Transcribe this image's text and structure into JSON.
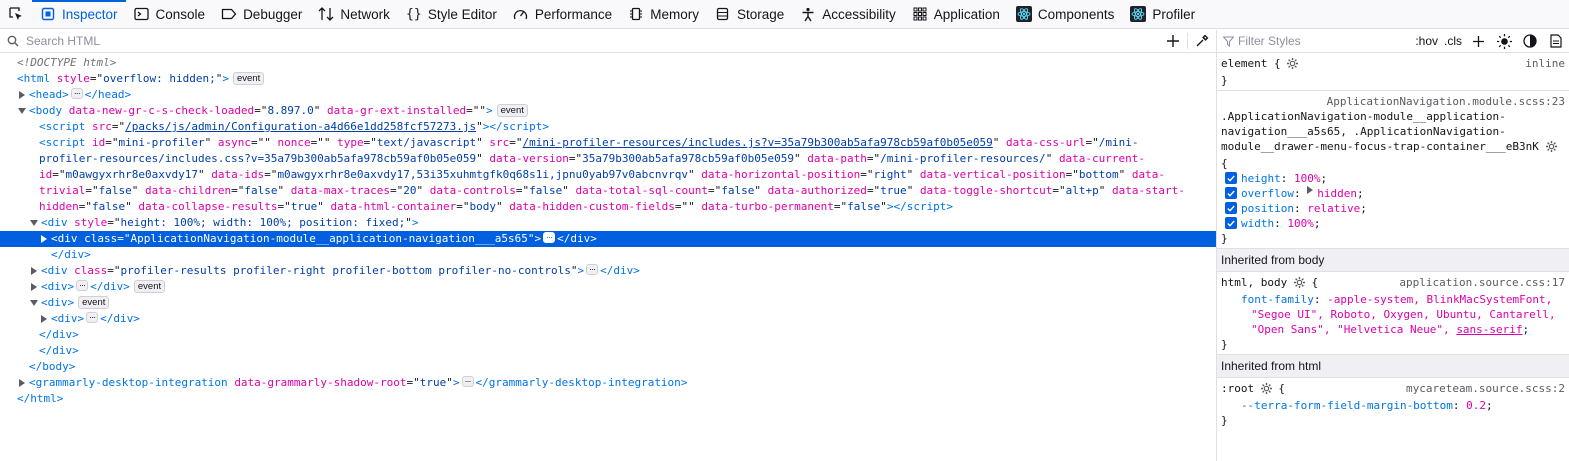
{
  "toolbar": {
    "tabs": [
      {
        "label": "Inspector",
        "icon": "inspector-icon",
        "selected": true
      },
      {
        "label": "Console",
        "icon": "console-icon"
      },
      {
        "label": "Debugger",
        "icon": "debugger-icon"
      },
      {
        "label": "Network",
        "icon": "network-icon"
      },
      {
        "label": "Style Editor",
        "icon": "style-editor-icon"
      },
      {
        "label": "Performance",
        "icon": "performance-icon"
      },
      {
        "label": "Memory",
        "icon": "memory-icon"
      },
      {
        "label": "Storage",
        "icon": "storage-icon"
      },
      {
        "label": "Accessibility",
        "icon": "accessibility-icon"
      },
      {
        "label": "Application",
        "icon": "application-icon"
      },
      {
        "label": "Components",
        "icon": "react-icon"
      },
      {
        "label": "Profiler",
        "icon": "react-icon"
      }
    ]
  },
  "markup": {
    "search_placeholder": "Search HTML",
    "lines": {
      "doctype": "<!DOCTYPE html>",
      "html_open": {
        "tag": "html",
        "attr1": "style",
        "val1": "overflow: hidden;",
        "badge": "event"
      },
      "head": {
        "open": "<head>",
        "close": "</head>"
      },
      "body_open": {
        "tag": "body",
        "attr1": "data-new-gr-c-s-check-loaded",
        "val1": "8.897.0",
        "attr2": "data-gr-ext-installed",
        "val2": "",
        "badge": "event"
      },
      "script1": {
        "attr": "src",
        "val": "/packs/js/admin/Configuration-a4d66e1dd258fcf57273.js"
      },
      "script2": {
        "id": "mini-profiler",
        "async": "",
        "nonce": "",
        "type": "text/javascript",
        "src": "/mini-profiler-resources/includes.js?v=35a79b300ab5afa978cb59af0b05e059",
        "data_css_url": "/mini-profiler-resources/includes.css?v=35a79b300ab5afa978cb59af0b05e059",
        "data_version": "35a79b300ab5afa978cb59af0b05e059",
        "data_path": "/mini-profiler-resources/",
        "data_current_id": "m0awgyxrhr8e0axvdy17",
        "data_ids": "m0awgyxrhr8e0axvdy17,53i35xuhmtgfk0q68s1i,jpnu0yab97v0abcnvrqv",
        "data_horizontal_position": "right",
        "data_vertical_position": "bottom",
        "data_trivial": "false",
        "data_children": "false",
        "data_max_traces": "20",
        "data_controls": "false",
        "data_total_sql_count": "false",
        "data_authorized": "true",
        "data_toggle_shortcut": "alt+p",
        "data_start_hidden": "false",
        "data_collapse_results": "true",
        "data_html_container": "body",
        "data_hidden_custom_fields": "",
        "data_turbo_permanent": "false"
      },
      "div_fixed": {
        "attr": "style",
        "val": "height: 100%; width: 100%; position: fixed;"
      },
      "div_nav": {
        "attr": "class",
        "val": "ApplicationNavigation-module__application-navigation___a5s65"
      },
      "div_profiler": {
        "attr": "class",
        "val": "profiler-results profiler-right profiler-bottom profiler-no-controls"
      },
      "div_event_badge": "event",
      "div_event2_badge": "event",
      "grammarly": {
        "tag": "grammarly-desktop-integration",
        "attr": "data-grammarly-shadow-root",
        "val": "true"
      }
    }
  },
  "rules": {
    "filter_placeholder": "Filter Styles",
    "hov": ":hov",
    "cls": ".cls",
    "element_rule": {
      "selector": "element {",
      "close": "}",
      "source": "inline"
    },
    "nav_rule": {
      "source": "ApplicationNavigation.module.scss:23",
      "selector_line1": ".ApplicationNavigation-module__application-",
      "selector_line2": "navigation___a5s65, .ApplicationNavigation-",
      "selector_line3": "module__drawer-menu-focus-trap-container___eB3nK",
      "open": "{",
      "close": "}",
      "decls": [
        {
          "prop": "height",
          "value": "100%"
        },
        {
          "prop": "overflow",
          "value": "hidden"
        },
        {
          "prop": "position",
          "value": "relative"
        },
        {
          "prop": "width",
          "value": "100%"
        }
      ]
    },
    "inherited_body_label": "Inherited from body",
    "body_rule": {
      "selector": "html, body",
      "source": "application.source.css:17",
      "prop": "font-family",
      "value_line1": "-apple-system, BlinkMacSystemFont,",
      "value_line2": "\"Segoe UI\", Roboto, Oxygen, Ubuntu, Cantarell,",
      "value_line3a": "\"Open Sans\", \"Helvetica Neue\", ",
      "value_line3b": "sans-serif"
    },
    "inherited_html_label": "Inherited from html",
    "root_rule": {
      "selector": ":root",
      "source": "mycareteam.source.scss:2",
      "prop": "--terra-form-field-margin-bottom",
      "value": "0.2"
    }
  },
  "colors": {
    "accent": "#0061e0",
    "selected_row": "#0060df",
    "tag": "#0074e8",
    "attr": "#dd00a9",
    "value": "#003eaa"
  }
}
